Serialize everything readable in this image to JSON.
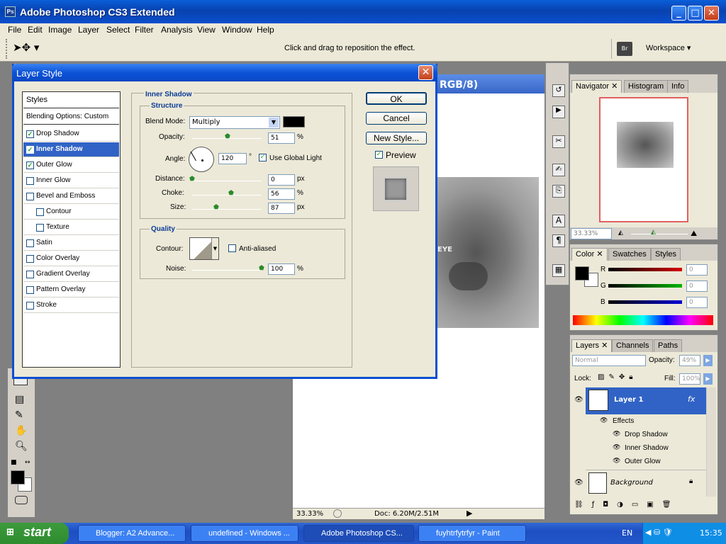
{
  "app": {
    "title": "Adobe Photoshop CS3 Extended",
    "icon": "Ps"
  },
  "menu": [
    "File",
    "Edit",
    "Image",
    "Layer",
    "Select",
    "Filter",
    "Analysis",
    "View",
    "Window",
    "Help"
  ],
  "options_bar": {
    "hint": "Click and drag to reposition the effect.",
    "workspace": "Workspace"
  },
  "document": {
    "title_fragment": "RGB/8)",
    "zoom": "33.33%",
    "doc_info": "Doc: 6.20M/2.51M",
    "image_text": "EYE"
  },
  "dialog": {
    "title": "Layer Style",
    "styles_header": "Styles",
    "blending": "Blending Options: Custom",
    "styles": [
      {
        "label": "Drop Shadow",
        "checked": true,
        "selected": false,
        "indent": false
      },
      {
        "label": "Inner Shadow",
        "checked": true,
        "selected": true,
        "indent": false
      },
      {
        "label": "Outer Glow",
        "checked": true,
        "selected": false,
        "indent": false
      },
      {
        "label": "Inner Glow",
        "checked": false,
        "selected": false,
        "indent": false
      },
      {
        "label": "Bevel and Emboss",
        "checked": false,
        "selected": false,
        "indent": false
      },
      {
        "label": "Contour",
        "checked": false,
        "selected": false,
        "indent": true
      },
      {
        "label": "Texture",
        "checked": false,
        "selected": false,
        "indent": true
      },
      {
        "label": "Satin",
        "checked": false,
        "selected": false,
        "indent": false
      },
      {
        "label": "Color Overlay",
        "checked": false,
        "selected": false,
        "indent": false
      },
      {
        "label": "Gradient Overlay",
        "checked": false,
        "selected": false,
        "indent": false
      },
      {
        "label": "Pattern Overlay",
        "checked": false,
        "selected": false,
        "indent": false
      },
      {
        "label": "Stroke",
        "checked": false,
        "selected": false,
        "indent": false
      }
    ],
    "section_title": "Inner Shadow",
    "structure_title": "Structure",
    "blend_mode_label": "Blend Mode:",
    "blend_mode": "Multiply",
    "opacity_label": "Opacity:",
    "opacity": "51",
    "angle_label": "Angle:",
    "angle": "120",
    "degree_symbol": "°",
    "use_global_light": "Use Global Light",
    "distance_label": "Distance:",
    "distance": "0",
    "choke_label": "Choke:",
    "choke": "56",
    "size_label": "Size:",
    "size": "87",
    "unit_percent": "%",
    "unit_px": "px",
    "quality_title": "Quality",
    "contour_label": "Contour:",
    "anti_aliased": "Anti-aliased",
    "noise_label": "Noise:",
    "noise": "100",
    "buttons": {
      "ok": "OK",
      "cancel": "Cancel",
      "new_style": "New Style...",
      "preview": "Preview"
    },
    "sliders": {
      "opacity": 0.51,
      "distance": 0.0,
      "choke": 0.56,
      "size": 0.35,
      "noise": 1.0
    }
  },
  "panels": {
    "navigator_tabs": [
      "Navigator",
      "Histogram",
      "Info"
    ],
    "navigator_zoom": "33.33%",
    "color_tabs": [
      "Color",
      "Swatches",
      "Styles"
    ],
    "color_channels": [
      {
        "label": "R",
        "value": "0",
        "color": "#d40000"
      },
      {
        "label": "G",
        "value": "0",
        "color": "#00b400"
      },
      {
        "label": "B",
        "value": "0",
        "color": "#0000d4"
      }
    ],
    "layers_tabs": [
      "Layers",
      "Channels",
      "Paths"
    ],
    "blend": "Normal",
    "opacity_label": "Opacity:",
    "opacity": "49%",
    "lock_label": "Lock:",
    "fill_label": "Fill:",
    "fill": "100%",
    "layers": [
      {
        "name": "Layer 1",
        "selected": true,
        "fx": "fx"
      },
      {
        "name": "Background",
        "selected": false,
        "locked": true
      }
    ],
    "effects_label": "Effects",
    "effects": [
      "Drop Shadow",
      "Inner Shadow",
      "Outer Glow"
    ]
  },
  "taskbar": {
    "start": "start",
    "tasks": [
      {
        "label": "Blogger: A2 Advance...",
        "active": false
      },
      {
        "label": "undefined - Windows ...",
        "active": false
      },
      {
        "label": "Adobe Photoshop CS...",
        "active": true
      },
      {
        "label": "fuyhtrfytrfyr - Paint",
        "active": false
      }
    ],
    "lang": "EN",
    "clock": "15:35"
  }
}
